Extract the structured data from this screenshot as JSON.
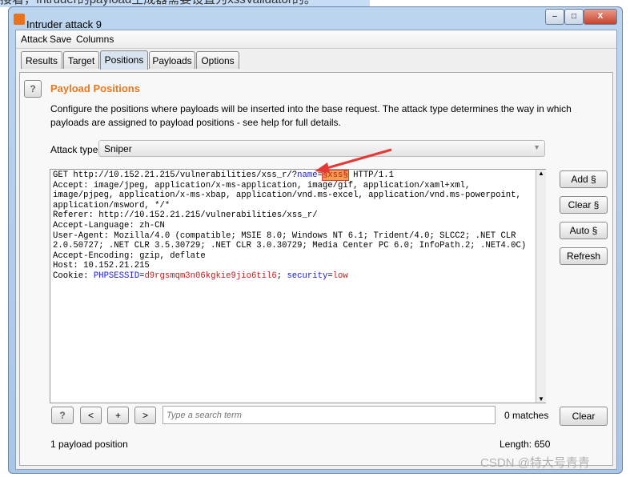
{
  "caption": "接着，Intruder的payload生成器需要设置为xssValidator的。",
  "window": {
    "title": "Intruder attack 9",
    "minimize": "–",
    "maximize": "□",
    "close": "X"
  },
  "menu": [
    "Attack",
    "Save",
    "Columns"
  ],
  "tabs": [
    {
      "label": "Results"
    },
    {
      "label": "Target"
    },
    {
      "label": "Positions",
      "active": true
    },
    {
      "label": "Payloads"
    },
    {
      "label": "Options"
    }
  ],
  "panel": {
    "help": "?",
    "title": "Payload Positions",
    "description1": "Configure the positions where payloads will be inserted into the base request. The attack type determines the way in which",
    "description2": "payloads are assigned to payload positions - see help for full details.",
    "attack_type_label": "Attack type:",
    "attack_type_value": "Sniper",
    "request": {
      "l1a": "GET http://10.152.21.215/vulnerabilities/xss_r/?",
      "l1k": "name",
      "l1eq": "=",
      "l1p": "§xss§",
      "l1b": " HTTP/1.1",
      "l2": "Accept: image/jpeg, application/x-ms-application, image/gif, application/xaml+xml,",
      "l3": "image/pjpeg, application/x-ms-xbap, application/vnd.ms-excel, application/vnd.ms-powerpoint,",
      "l4": "application/msword, */*",
      "l5": "Referer: http://10.152.21.215/vulnerabilities/xss_r/",
      "l6": "Accept-Language: zh-CN",
      "l7": "User-Agent: Mozilla/4.0 (compatible; MSIE 8.0; Windows NT 6.1; Trident/4.0; SLCC2; .NET CLR",
      "l8": "2.0.50727; .NET CLR 3.5.30729; .NET CLR 3.0.30729; Media Center PC 6.0; InfoPath.2; .NET4.0C)",
      "l9": "Accept-Encoding: gzip, deflate",
      "l10": "Host: 10.152.21.215",
      "l11a": "Cookie: ",
      "l11k1": "PHPSESSID",
      "l11eq": "=",
      "l11v1": "d9rgsmqm3n06kgkie9jio6til6",
      "l11s": "; ",
      "l11k2": "security",
      "l11v2": "low"
    },
    "buttons": {
      "add": "Add §",
      "clear": "Clear §",
      "auto": "Auto §",
      "refresh": "Refresh"
    },
    "search": {
      "help": "?",
      "prev": "<",
      "plus": "+",
      "next": ">",
      "placeholder": "Type a search term",
      "matches": "0 matches",
      "clear": "Clear"
    },
    "footer": {
      "positions": "1 payload position",
      "length": "Length: 650"
    }
  },
  "watermark": "CSDN @特大号青青",
  "colors": {
    "accent": "#e8781e",
    "payload_highlight": "#f0a050",
    "annotation_arrow": "#e53935"
  }
}
